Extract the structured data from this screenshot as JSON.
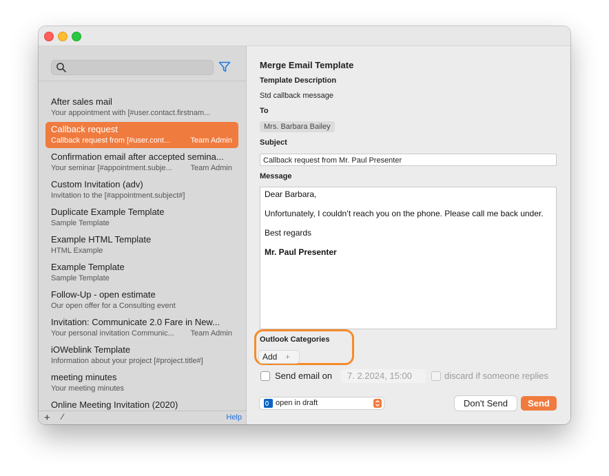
{
  "window": {
    "traffic_lights": [
      "close",
      "minimize",
      "zoom"
    ]
  },
  "sidebar": {
    "search_placeholder": "",
    "items": [
      {
        "title": "After sales mail",
        "subtitle": "Your appointment with [#user.contact.firstnam...",
        "owner": ""
      },
      {
        "title": "Callback request",
        "subtitle": "Callback request from [#user.cont...",
        "owner": "Team Admin",
        "selected": true
      },
      {
        "title": "Confirmation email after accepted semina...",
        "subtitle": "Your seminar [#appointment.subje...",
        "owner": "Team Admin"
      },
      {
        "title": "Custom Invitation (adv)",
        "subtitle": "Invitation to the [#appointment.subject#]",
        "owner": ""
      },
      {
        "title": "Duplicate Example Template",
        "subtitle": "Sample Template",
        "owner": ""
      },
      {
        "title": "Example HTML Template",
        "subtitle": "HTML Example",
        "owner": ""
      },
      {
        "title": "Example Template",
        "subtitle": "Sample Template",
        "owner": ""
      },
      {
        "title": "Follow-Up - open estimate",
        "subtitle": "Our open offer for a Consulting event",
        "owner": ""
      },
      {
        "title": "Invitation: Communicate 2.0 Fare in New...",
        "subtitle": "Your personal invitation Communic...",
        "owner": "Team Admin"
      },
      {
        "title": "iOWeblink Template",
        "subtitle": "Information about your project [#project.title#]",
        "owner": ""
      },
      {
        "title": "meeting minutes",
        "subtitle": "Your meeting minutes",
        "owner": ""
      },
      {
        "title": "Online Meeting Invitation (2020)",
        "subtitle": "",
        "owner": ""
      }
    ],
    "bottom": {
      "add": "+",
      "edit": "⁄",
      "help": "Help"
    }
  },
  "main": {
    "title": "Merge Email Template",
    "template_description_label": "Template Description",
    "template_description_value": "Std callback message",
    "to_label": "To",
    "to_value": "Mrs. Barbara Bailey",
    "subject_label": "Subject",
    "subject_value": "Callback request from Mr. Paul Presenter",
    "message_label": "Message",
    "message_lines": [
      "Dear  Barbara,",
      "Unfortunately, I couldn’t reach you on the phone. Please call me back under.",
      "Best regards",
      "Mr. Paul Presenter"
    ],
    "outlook_categories_label": "Outlook Categories",
    "add_category_label": "Add",
    "add_category_plus": "+",
    "send_email_on_label": "Send email on",
    "send_email_on_checked": false,
    "date_value": "7.  2.2024, 15:00",
    "discard_label": "discard if someone replies",
    "discard_checked": false,
    "mode_value": "open in draft",
    "dont_send_label": "Don't Send",
    "send_label": "Send"
  },
  "colors": {
    "accent": "#f07b3f",
    "highlight_ring": "#f68b2a",
    "link": "#1d6ed8",
    "filter": "#1d7be6"
  }
}
